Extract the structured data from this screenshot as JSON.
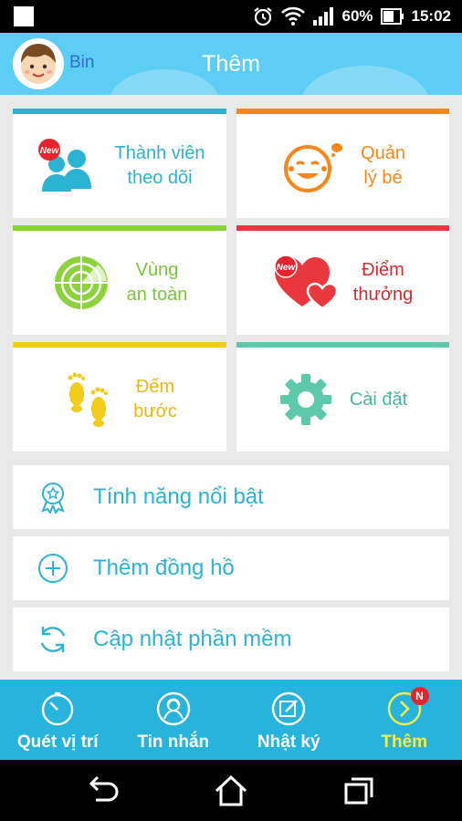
{
  "status_bar": {
    "battery": "60%",
    "time": "15:02"
  },
  "header": {
    "user_name": "Bin",
    "title": "Thêm"
  },
  "tiles": [
    {
      "label": "Thành viên\ntheo dõi",
      "color": "#2bb3d4",
      "text_color": "#2bb3d4",
      "icon": "family-members-icon",
      "badge": "New"
    },
    {
      "label": "Quản\nlý bé",
      "color": "#f7861b",
      "text_color": "#f7861b",
      "icon": "baby-face-icon"
    },
    {
      "label": "Vùng\nan toàn",
      "color": "#8cd23c",
      "text_color": "#7cc43a",
      "icon": "radar-icon"
    },
    {
      "label": "Điểm\nthưởng",
      "color": "#e8373d",
      "text_color": "#d42a31",
      "icon": "hearts-icon",
      "badge": "New"
    },
    {
      "label": "Đếm\nbước",
      "color": "#f2cc1b",
      "text_color": "#e8b90c",
      "icon": "footprints-icon"
    },
    {
      "label": "Cài đặt",
      "color": "#5ec8aa",
      "text_color": "#46b89a",
      "icon": "gear-icon"
    }
  ],
  "features": [
    {
      "label": "Tính năng nổi bật",
      "icon": "award-icon"
    },
    {
      "label": "Thêm đồng hồ",
      "icon": "plus-circle-icon"
    },
    {
      "label": "Cập nhật phần mềm",
      "icon": "refresh-icon"
    }
  ],
  "bottom_nav": [
    {
      "label": "Quét vị trí",
      "icon": "stopwatch-icon",
      "active": false
    },
    {
      "label": "Tin nhắn",
      "icon": "chat-avatar-icon",
      "active": false
    },
    {
      "label": "Nhật ký",
      "icon": "edit-icon",
      "active": false
    },
    {
      "label": "Thêm",
      "icon": "more-arrow-icon",
      "active": true,
      "badge": "N"
    }
  ],
  "colors": {
    "header": "#5ccdf3",
    "nav": "#27b3dc",
    "active_nav": "#f5ec4a",
    "accent": "#2bb3d4"
  }
}
